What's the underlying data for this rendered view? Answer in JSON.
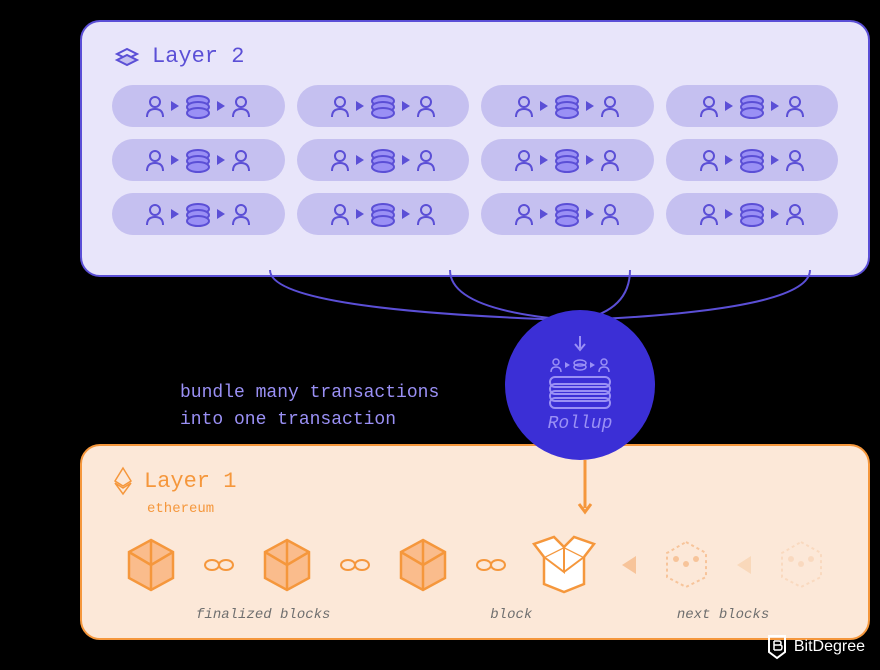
{
  "layer2": {
    "title": "Layer 2",
    "iconName": "stacked-layers-icon"
  },
  "bundle_text_line1": "bundle many transactions",
  "bundle_text_line2": "into one transaction",
  "rollup": {
    "label": "Rollup"
  },
  "layer1": {
    "title": "Layer 1",
    "subtitle": "ethereum",
    "finalized_label": "finalized blocks",
    "block_label": "block",
    "next_label": "next blocks"
  },
  "watermark": "BitDegree",
  "colors": {
    "purple_light": "#e8e5fa",
    "purple_mid": "#c5c0f0",
    "purple_dark": "#5b4fd6",
    "purple_deep": "#3b2fd6",
    "purple_text": "#9a90f5",
    "orange_light": "#fce8d8",
    "orange_dark": "#f5973c"
  }
}
